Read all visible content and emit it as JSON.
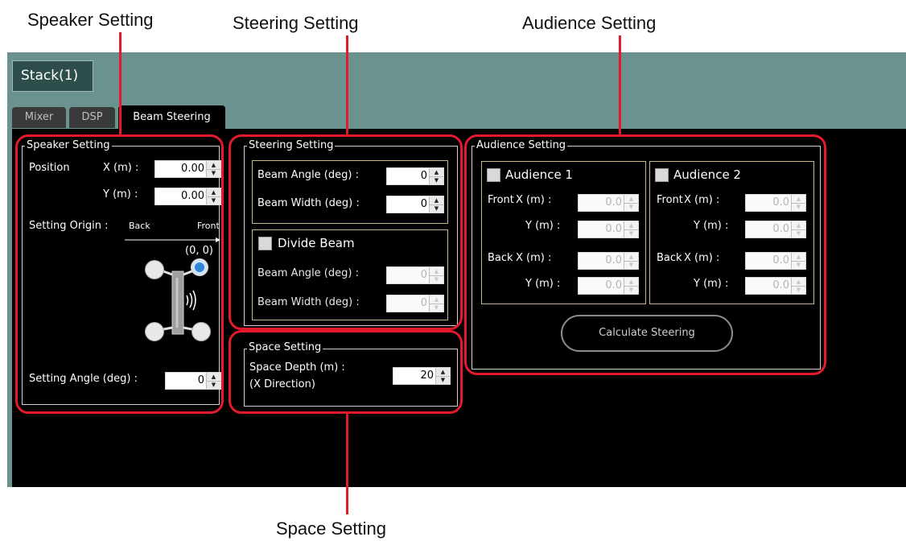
{
  "callouts": {
    "speaker": "Speaker Setting",
    "steering": "Steering Setting",
    "audience": "Audience Setting",
    "space": "Space Setting"
  },
  "app": {
    "stack_label": "Stack(1)",
    "tabs": [
      "Mixer",
      "DSP",
      "Beam Steering"
    ],
    "active_tab": "Beam Steering"
  },
  "speaker_setting": {
    "title": "Speaker Setting",
    "position_label": "Position",
    "x_label": "X (m) :",
    "y_label": "Y (m) :",
    "x_value": "0.00",
    "y_value": "0.00",
    "origin_label": "Setting Origin :",
    "back_label": "Back",
    "front_label": "Front",
    "origin_coords": "(0, 0)",
    "angle_label": "Setting Angle (deg) :",
    "angle_value": "0"
  },
  "steering_setting": {
    "title": "Steering Setting",
    "beam_angle_label": "Beam Angle (deg) :",
    "beam_angle_value": "0",
    "beam_width_label": "Beam Width (deg) :",
    "beam_width_value": "0",
    "divide_beam_label": "Divide Beam",
    "divide_angle_label": "Beam Angle (deg) :",
    "divide_angle_value": "0",
    "divide_width_label": "Beam Width (deg) :",
    "divide_width_value": "0"
  },
  "space_setting": {
    "title": "Space Setting",
    "depth_label_1": "Space Depth (m) :",
    "depth_label_2": "(X Direction)",
    "depth_value": "20"
  },
  "audience_setting": {
    "title": "Audience Setting",
    "audience1": {
      "label": "Audience 1",
      "front_label": "Front",
      "back_label": "Back",
      "x_label": "X (m) :",
      "y_label": "Y (m) :",
      "front_x": "0.0",
      "front_y": "0.0",
      "back_x": "0.0",
      "back_y": "0.0"
    },
    "audience2": {
      "label": "Audience 2",
      "front_label": "Front",
      "back_label": "Back",
      "x_label": "X (m) :",
      "y_label": "Y (m) :",
      "front_x": "0.0",
      "front_y": "0.0",
      "back_x": "0.0",
      "back_y": "0.0"
    },
    "calculate_label": "Calculate Steering"
  },
  "colors": {
    "callout_red": "#e21a2c",
    "app_teal": "#6a9390",
    "panel_black": "#000000"
  }
}
